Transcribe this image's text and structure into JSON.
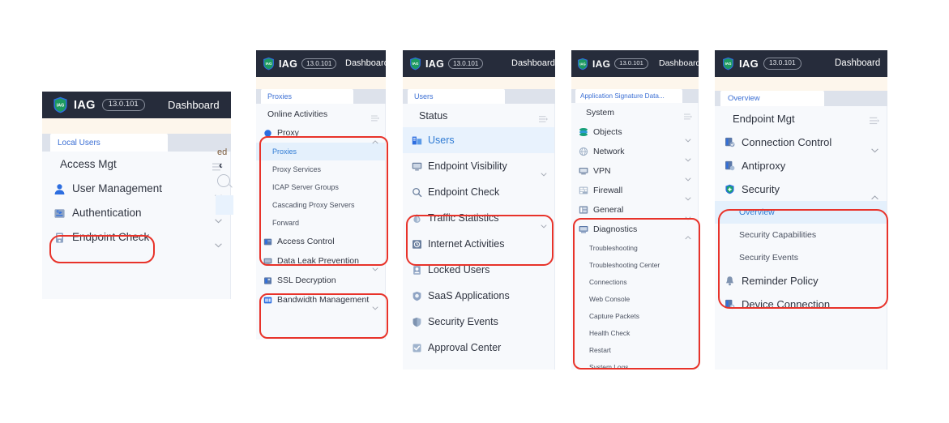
{
  "brand": {
    "name": "IAG",
    "version": "13.0.101",
    "logo_text": "IAG",
    "topbar_menu": "Dashboard",
    "topbar_bg": "#262c3b",
    "accent": "#2f7bd4",
    "annotation_color": "#e8332a"
  },
  "panels": [
    {
      "id": "local-users",
      "tab": "Local Users",
      "header": "Access Mgt",
      "items": [
        {
          "label": "User Management",
          "icon": "user-icon",
          "chevron": "down",
          "active": false
        },
        {
          "label": "Authentication",
          "icon": "authentication-icon",
          "chevron": "down",
          "active": false,
          "highlighted": true
        },
        {
          "label": "Endpoint Check",
          "icon": "endpoint-check-icon",
          "chevron": "down",
          "active": false
        }
      ],
      "fragments": {
        "text": "ed",
        "chevron": "‹"
      }
    },
    {
      "id": "proxies",
      "tab": "Proxies",
      "header": "Online Activities",
      "items": [
        {
          "label": "Proxy",
          "icon": "proxy-icon",
          "chevron": "up",
          "active": false,
          "highlighted": true,
          "subitems": [
            {
              "label": "Proxies",
              "active": true
            },
            {
              "label": "Proxy Services",
              "active": false
            },
            {
              "label": "ICAP Server Groups",
              "active": false
            },
            {
              "label": "Cascading Proxy Servers",
              "active": false
            },
            {
              "label": "Forward",
              "active": false
            }
          ]
        },
        {
          "label": "Access Control",
          "icon": "access-control-icon",
          "chevron": "none",
          "active": false,
          "highlighted": true
        },
        {
          "label": "Data Leak Prevention",
          "icon": "data-leak-prevention-icon",
          "chevron": "down",
          "active": false
        },
        {
          "label": "SSL Decryption",
          "icon": "ssl-decryption-icon",
          "chevron": "none",
          "active": false,
          "highlighted": true
        },
        {
          "label": "Bandwidth Management",
          "icon": "bandwidth-management-icon",
          "chevron": "down",
          "active": false,
          "highlighted": true
        }
      ]
    },
    {
      "id": "users",
      "tab": "Users",
      "header": "Status",
      "items": [
        {
          "label": "Users",
          "icon": "users-icon",
          "chevron": "none",
          "active": true
        },
        {
          "label": "Endpoint Visibility",
          "icon": "endpoint-visibility-icon",
          "chevron": "down",
          "active": false
        },
        {
          "label": "Endpoint Check",
          "icon": "search-icon",
          "chevron": "none",
          "active": false
        },
        {
          "label": "Traffic Statistics",
          "icon": "traffic-statistics-icon",
          "chevron": "down",
          "active": false,
          "highlighted": true
        },
        {
          "label": "Internet Activities",
          "icon": "internet-activities-icon",
          "chevron": "none",
          "active": false,
          "highlighted": true
        },
        {
          "label": "Locked Users",
          "icon": "locked-users-icon",
          "chevron": "none",
          "active": false
        },
        {
          "label": "SaaS Applications",
          "icon": "saas-applications-icon",
          "chevron": "none",
          "active": false
        },
        {
          "label": "Security Events",
          "icon": "security-events-icon",
          "chevron": "none",
          "active": false
        },
        {
          "label": "Approval Center",
          "icon": "approval-center-icon",
          "chevron": "none",
          "active": false
        }
      ]
    },
    {
      "id": "system",
      "tab": "Application Signature Data...",
      "header": "System",
      "items": [
        {
          "label": "Objects",
          "icon": "objects-icon",
          "chevron": "down",
          "active": false
        },
        {
          "label": "Network",
          "icon": "network-icon",
          "chevron": "down",
          "active": false
        },
        {
          "label": "VPN",
          "icon": "vpn-icon",
          "chevron": "down",
          "active": false
        },
        {
          "label": "Firewall",
          "icon": "firewall-icon",
          "chevron": "down",
          "active": false
        },
        {
          "label": "General",
          "icon": "general-icon",
          "chevron": "down",
          "active": false
        },
        {
          "label": "Diagnostics",
          "icon": "diagnostics-icon",
          "chevron": "up",
          "active": false,
          "highlighted": true,
          "subitems": [
            {
              "label": "Troubleshooting",
              "active": false
            },
            {
              "label": "Troubleshooting Center",
              "active": false
            },
            {
              "label": "Connections",
              "active": false
            },
            {
              "label": "Web Console",
              "active": false
            },
            {
              "label": "Capture Packets",
              "active": false
            },
            {
              "label": "Health Check",
              "active": false
            },
            {
              "label": "Restart",
              "active": false
            },
            {
              "label": "System Logs",
              "active": false
            }
          ]
        }
      ]
    },
    {
      "id": "overview",
      "tab": "Overview",
      "header": "Endpoint Mgt",
      "items": [
        {
          "label": "Connection Control",
          "icon": "connection-control-icon",
          "chevron": "down",
          "active": false
        },
        {
          "label": "Antiproxy",
          "icon": "antiproxy-icon",
          "chevron": "none",
          "active": false
        },
        {
          "label": "Security",
          "icon": "security-icon",
          "chevron": "up",
          "active": false,
          "highlighted": true,
          "subitems": [
            {
              "label": "Overview",
              "active": true
            },
            {
              "label": "Security Capabilities",
              "active": false
            },
            {
              "label": "Security Events",
              "active": false
            }
          ]
        },
        {
          "label": "Reminder Policy",
          "icon": "reminder-policy-icon",
          "chevron": "none",
          "active": false
        },
        {
          "label": "Device Connection",
          "icon": "device-connection-icon",
          "chevron": "none",
          "active": false
        }
      ]
    }
  ]
}
